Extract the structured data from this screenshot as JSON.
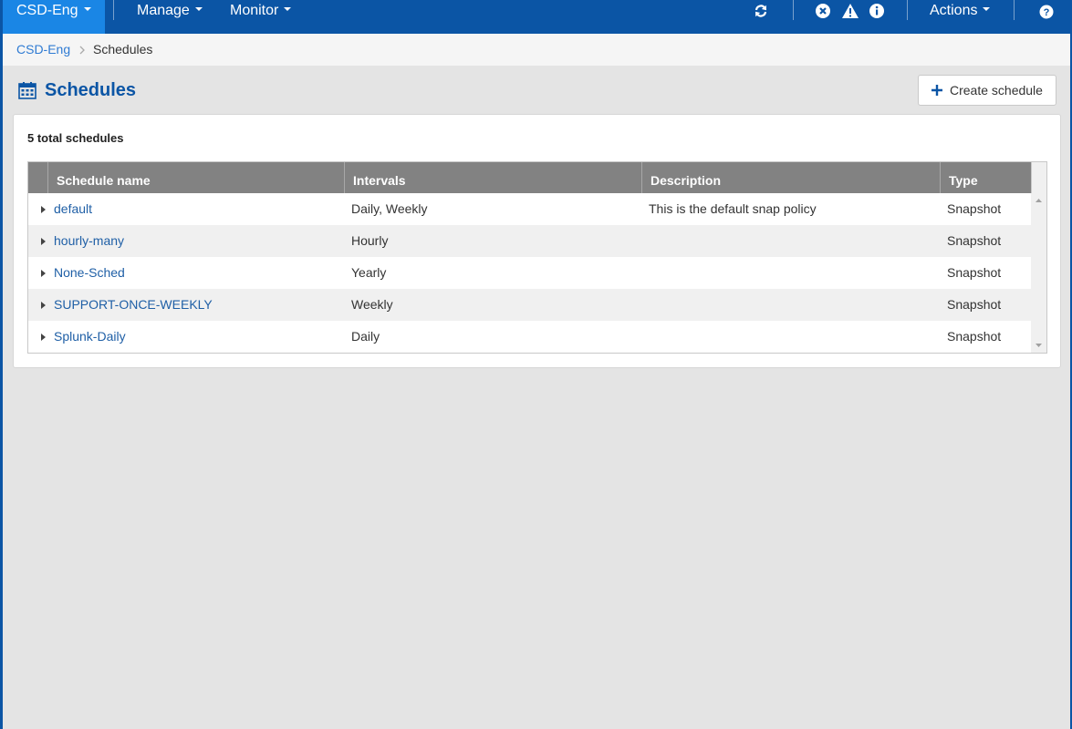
{
  "navbar": {
    "cluster_label": "CSD-Eng",
    "manage_label": "Manage",
    "monitor_label": "Monitor",
    "actions_label": "Actions",
    "icons": [
      "refresh-icon",
      "error-icon",
      "warning-icon",
      "info-icon",
      "help-icon"
    ],
    "colors": {
      "bar": "#0b55a5",
      "active": "#1a86e5"
    }
  },
  "breadcrumb": {
    "root": "CSD-Eng",
    "current": "Schedules"
  },
  "page": {
    "title": "Schedules",
    "create_button": "Create schedule",
    "total_label": "5 total schedules"
  },
  "table": {
    "columns": [
      "Schedule name",
      "Intervals",
      "Description",
      "Type"
    ],
    "rows": [
      {
        "name": "default",
        "intervals": "Daily, Weekly",
        "description": "This is the default snap policy",
        "type": "Snapshot"
      },
      {
        "name": "hourly-many",
        "intervals": "Hourly",
        "description": "",
        "type": "Snapshot"
      },
      {
        "name": "None-Sched",
        "intervals": "Yearly",
        "description": "",
        "type": "Snapshot"
      },
      {
        "name": "SUPPORT-ONCE-WEEKLY",
        "intervals": "Weekly",
        "description": "",
        "type": "Snapshot"
      },
      {
        "name": "Splunk-Daily",
        "intervals": "Daily",
        "description": "",
        "type": "Snapshot"
      }
    ]
  }
}
